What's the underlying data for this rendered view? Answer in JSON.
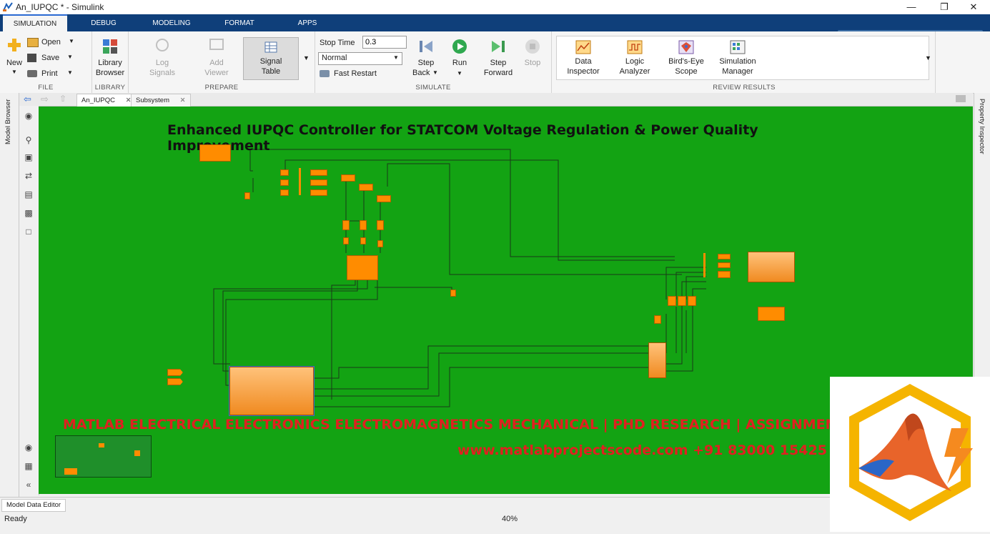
{
  "window": {
    "title": "An_IUPQC * - Simulink"
  },
  "ribbon_tabs": [
    {
      "label": "SIMULATION",
      "active": true
    },
    {
      "label": "DEBUG"
    },
    {
      "label": "MODELING"
    },
    {
      "label": "FORMAT"
    },
    {
      "label": "APPS"
    }
  ],
  "file": {
    "new": "New",
    "open": "Open",
    "save": "Save",
    "print": "Print",
    "section": "FILE"
  },
  "library": {
    "browser_line1": "Library",
    "browser_line2": "Browser",
    "section": "LIBRARY"
  },
  "prepare": {
    "log_line1": "Log",
    "log_line2": "Signals",
    "add_line1": "Add",
    "add_line2": "Viewer",
    "signal_line1": "Signal",
    "signal_line2": "Table",
    "section": "PREPARE"
  },
  "simulate": {
    "stop_time_label": "Stop Time",
    "stop_time_value": "0.3",
    "mode": "Normal",
    "fast_restart": "Fast Restart",
    "step_back_line1": "Step",
    "step_back_line2": "Back",
    "run": "Run",
    "step_forward_line1": "Step",
    "step_forward_line2": "Forward",
    "stop": "Stop",
    "section": "SIMULATE"
  },
  "review": {
    "data_line1": "Data",
    "data_line2": "Inspector",
    "logic_line1": "Logic",
    "logic_line2": "Analyzer",
    "birds_line1": "Bird's-Eye",
    "birds_line2": "Scope",
    "sim_line1": "Simulation",
    "sim_line2": "Manager",
    "section": "REVIEW RESULTS"
  },
  "editor_tabs": [
    {
      "label": "An_IUPQC"
    },
    {
      "label": "Subsystem"
    }
  ],
  "side": {
    "model_browser": "Model Browser",
    "property_inspector": "Property Inspector"
  },
  "canvas": {
    "title": "Enhanced IUPQC Controller for STATCOM  Voltage Regulation & Power Quality Improvement",
    "watermark1": "MATLAB ELECTRICAL ELECTRONICS ELECTROMAGNETICS MECHANICAL | PHD RESEARCH | ASSIGNMENTS",
    "watermark2": "www.matlabprojectscode.com +91 83000 15425"
  },
  "status": {
    "model_data_editor": "Model Data Editor",
    "ready": "Ready",
    "zoom": "40%"
  },
  "colors": {
    "canvas": "#13a313",
    "block": "#ff8c00",
    "ribbon": "#0f3f7a",
    "watermark": "#e02020"
  }
}
